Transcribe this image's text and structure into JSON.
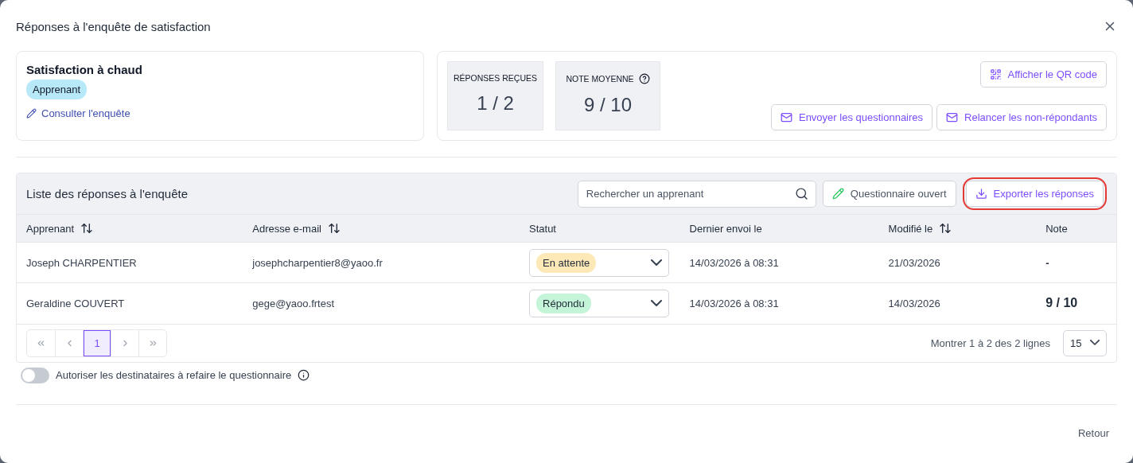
{
  "dialog": {
    "title": "Réponses à l'enquête de satisfaction"
  },
  "survey": {
    "name": "Satisfaction à chaud",
    "audience_tag": "Apprenant",
    "link": "Consulter l'enquête"
  },
  "stats": [
    {
      "label": "RÉPONSES REÇUES",
      "value": "1 / 2",
      "help": false
    },
    {
      "label": "NOTE MOYENNE",
      "value": "9 / 10",
      "help": true
    }
  ],
  "actions": {
    "qr_button": "Afficher le QR code",
    "send_button": "Envoyer les questionnaires",
    "remind_button": "Relancer les non-répondants"
  },
  "responses": {
    "title": "Liste des réponses à l'enquête",
    "search": {
      "placeholder": "Rechercher un apprenant"
    },
    "open_button": "Questionnaire ouvert",
    "export_button": {
      "label": "Exporter les réponses",
      "highlighted": true
    },
    "columns": [
      {
        "label": "Apprenant",
        "sortable": true
      },
      {
        "label": "Adresse e-mail",
        "sortable": true
      },
      {
        "label": "Statut",
        "sortable": false
      },
      {
        "label": "Dernier envoi le",
        "sortable": false
      },
      {
        "label": "Modifié le",
        "sortable": true
      },
      {
        "label": "Note",
        "sortable": false
      }
    ],
    "rows": [
      {
        "name": "Joseph CHARPENTIER",
        "email": "josephcharpentier8@yaoo.fr",
        "status": "En attente",
        "color": "#fde8b8",
        "last_sent": "14/03/2026 à 08:31",
        "modified": "21/03/2026",
        "note": "-"
      },
      {
        "name": "Geraldine COUVERT",
        "email": "gege@yaoo.frtest",
        "status": "Répondu",
        "color": "#c4f5d8",
        "last_sent": "14/03/2026 à 08:31",
        "modified": "14/03/2026",
        "note": "9 / 10"
      }
    ],
    "pagination": {
      "pages": [
        {
          "label": "1",
          "selected": true
        }
      ],
      "summary": "Montrer 1 à 2 des 2 lignes",
      "page_size": "15"
    }
  },
  "retake_toggle": {
    "label": "Autoriser les destinataires à refaire le questionnaire",
    "on": false
  },
  "footer": {
    "back_link": "Retour"
  }
}
